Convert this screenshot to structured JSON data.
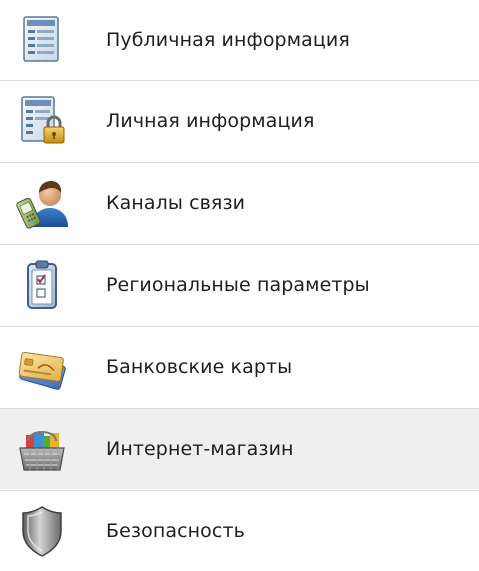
{
  "menu": {
    "items": [
      {
        "label": "Публичная информация",
        "icon": "public-info-document-icon"
      },
      {
        "label": "Личная информация",
        "icon": "private-info-document-lock-icon"
      },
      {
        "label": "Каналы связи",
        "icon": "contact-person-phone-icon"
      },
      {
        "label": "Региональные параметры",
        "icon": "regional-settings-clipboard-icon"
      },
      {
        "label": "Банковские карты",
        "icon": "bank-cards-icon"
      },
      {
        "label": "Интернет-магазин",
        "icon": "online-shop-basket-icon",
        "selected": true
      },
      {
        "label": "Безопасность",
        "icon": "security-shield-icon"
      }
    ]
  },
  "colors": {
    "background": "#ffffff",
    "selected_background": "#efefef",
    "divider": "#dcdcdc",
    "text": "#1e1e1e"
  }
}
